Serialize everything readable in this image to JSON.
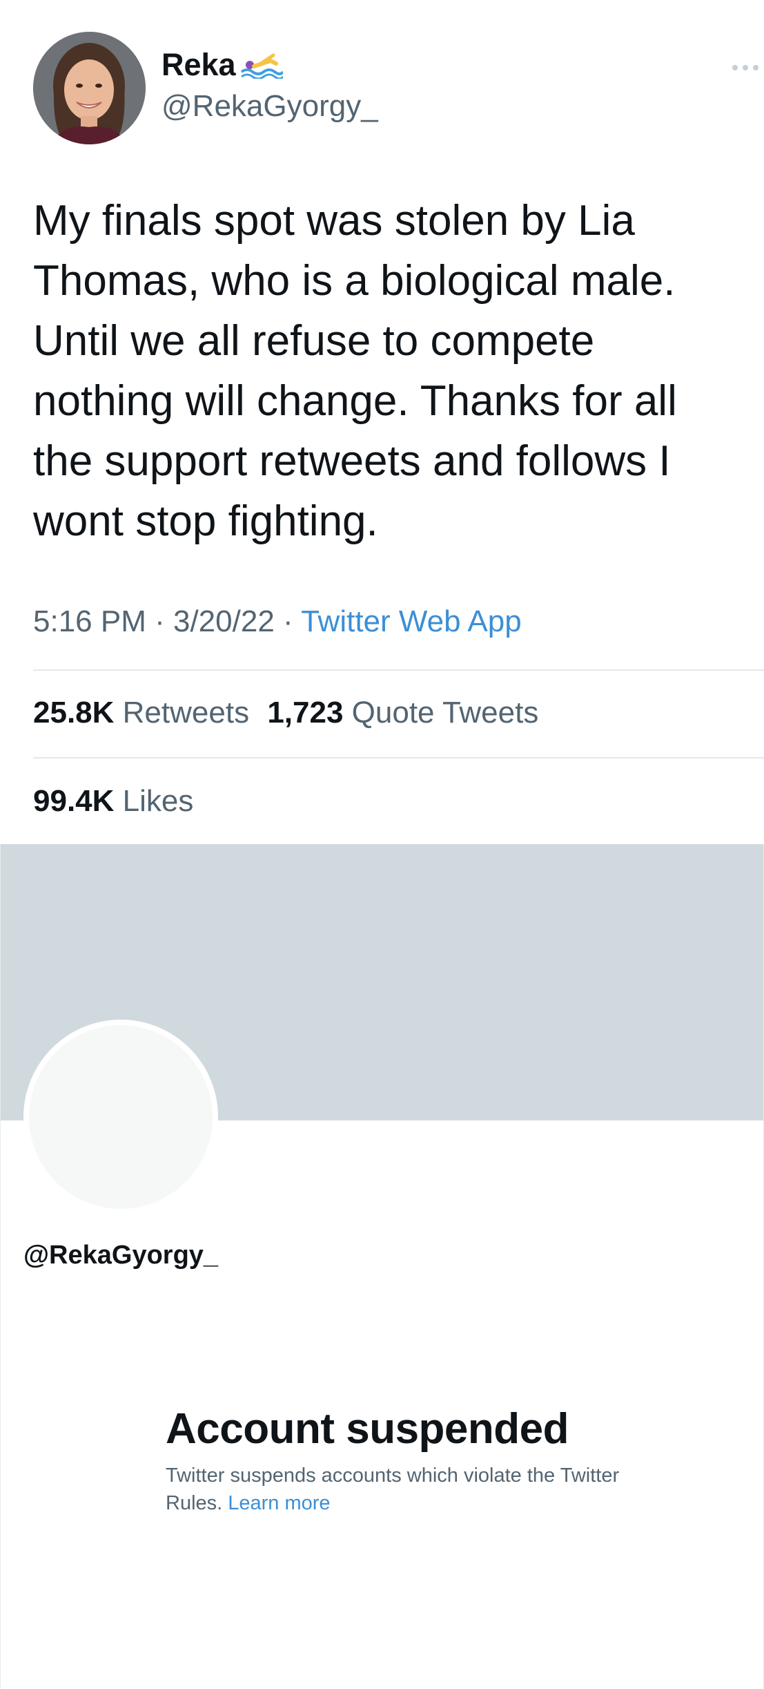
{
  "tweet": {
    "author": {
      "display_name": "Reka",
      "name_emoji": "swimmer-emoji-icon",
      "handle": "@RekaGyorgy_"
    },
    "more_icon": "more-horizontal-icon",
    "text": "My finals spot was stolen by Lia\nThomas, who is a biological male.\nUntil we all refuse to compete\nnothing will change. Thanks for all\nthe support retweets and follows I\nwont stop fighting.",
    "time": "5:16 PM",
    "separator": " · ",
    "date": "3/20/22",
    "source": "Twitter Web App",
    "stats": {
      "retweets_count": "25.8K",
      "retweets_label": "Retweets",
      "quote_tweets_count": "1,723",
      "quote_tweets_label": "Quote Tweets",
      "likes_count": "99.4K",
      "likes_label": "Likes"
    }
  },
  "profile": {
    "handle": "@RekaGyorgy_",
    "banner_color": "#cfd9de",
    "suspended": {
      "title": "Account suspended",
      "body": "Twitter suspends accounts which violate the Twitter Rules.",
      "link": "Learn more"
    }
  },
  "colors": {
    "text_primary": "#0f1419",
    "text_secondary": "#536471",
    "accent_link": "#3b8fd6",
    "divider": "#e4e8ea"
  }
}
